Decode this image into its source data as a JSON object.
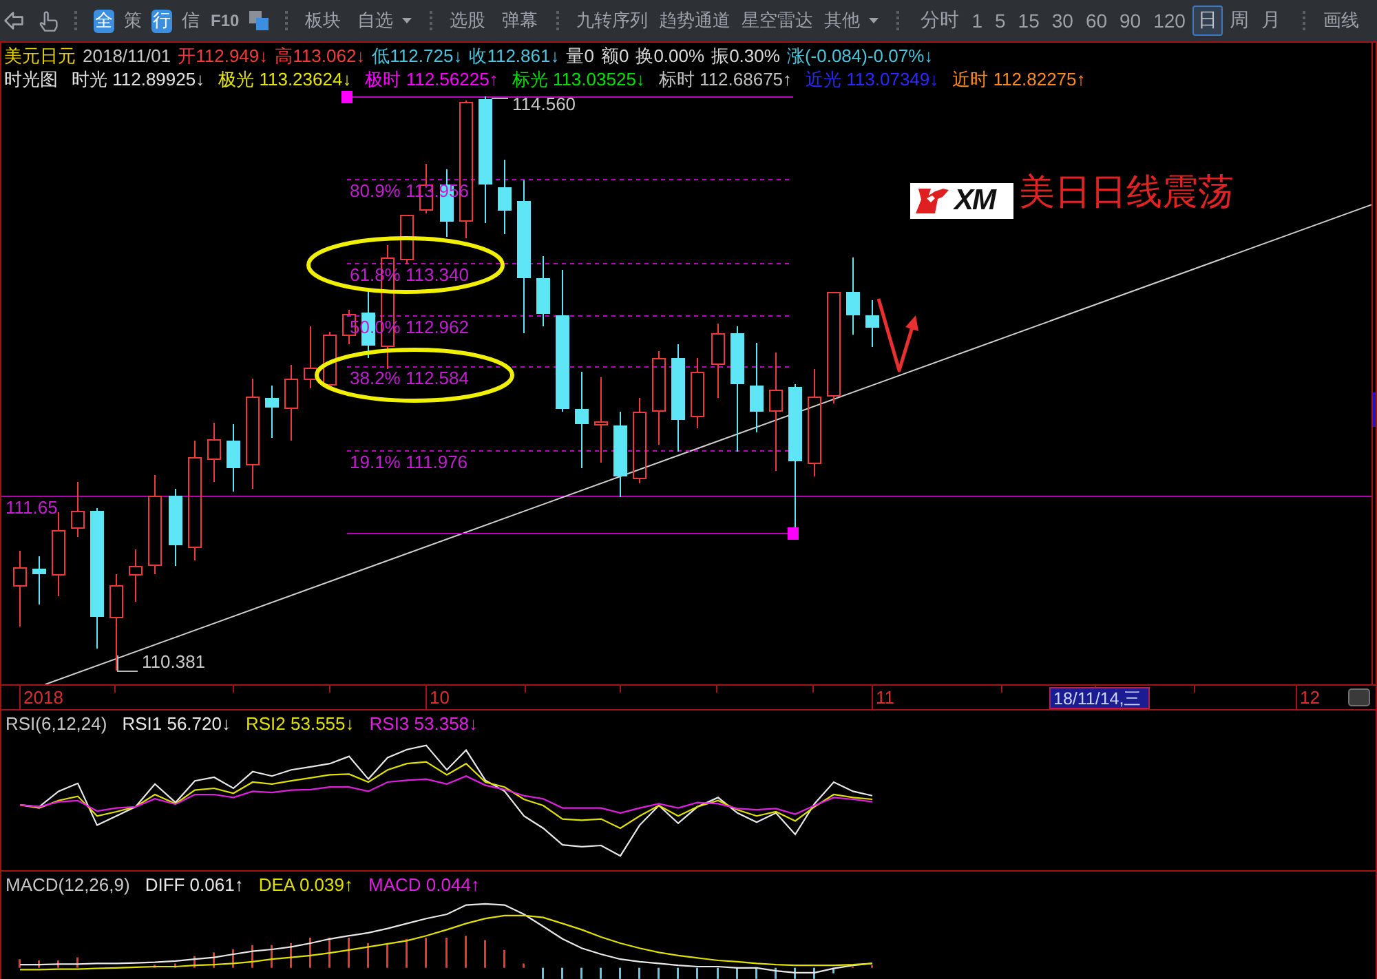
{
  "toolbar": {
    "groups": [
      {
        "items": [
          {
            "kind": "badge",
            "label": "全"
          },
          {
            "kind": "text",
            "label": "策"
          },
          {
            "kind": "badge",
            "label": "行"
          },
          {
            "kind": "text",
            "label": "信"
          },
          {
            "kind": "text",
            "label": "F10"
          }
        ]
      },
      {
        "items": [
          {
            "kind": "text",
            "label": "板块"
          },
          {
            "kind": "dropdown",
            "label": "自选"
          }
        ]
      },
      {
        "items": [
          {
            "kind": "text",
            "label": "选股"
          },
          {
            "kind": "text",
            "label": "弹幕"
          }
        ]
      },
      {
        "items": [
          {
            "kind": "text",
            "label": "九转序列"
          },
          {
            "kind": "text",
            "label": "趋势通道"
          },
          {
            "kind": "text",
            "label": "星空雷达"
          },
          {
            "kind": "dropdown",
            "label": "其他"
          }
        ]
      },
      {
        "items": [
          {
            "kind": "tab",
            "label": "分时",
            "selected": false
          },
          {
            "kind": "tab",
            "label": "1",
            "selected": false
          },
          {
            "kind": "tab",
            "label": "5",
            "selected": false
          },
          {
            "kind": "tab",
            "label": "15",
            "selected": false
          },
          {
            "kind": "tab",
            "label": "30",
            "selected": false
          },
          {
            "kind": "tab",
            "label": "60",
            "selected": false
          },
          {
            "kind": "tab",
            "label": "90",
            "selected": false
          },
          {
            "kind": "tab",
            "label": "120",
            "selected": false
          },
          {
            "kind": "tab",
            "label": "日",
            "selected": true
          },
          {
            "kind": "tab",
            "label": "周",
            "selected": false
          },
          {
            "kind": "tab",
            "label": "月",
            "selected": false
          }
        ]
      },
      {
        "items": [
          {
            "kind": "text",
            "label": "画线"
          }
        ]
      }
    ]
  },
  "chart": {
    "quote": [
      {
        "text": "美元日元",
        "color": "#e6d000"
      },
      {
        "text": "2018/11/01",
        "color": "#c8c8c8"
      },
      {
        "text": "开112.949↓",
        "color": "#f23b3b"
      },
      {
        "text": "高113.062↓",
        "color": "#f23b3b"
      },
      {
        "text": "低112.725↓",
        "color": "#4cc4dc"
      },
      {
        "text": "收112.861↓",
        "color": "#4cc4dc"
      },
      {
        "text": "量0",
        "color": "#d8d8d8"
      },
      {
        "text": "额0",
        "color": "#d8d8d8"
      },
      {
        "text": "换0.00%",
        "color": "#d8d8d8"
      },
      {
        "text": "振0.30%",
        "color": "#d8d8d8"
      },
      {
        "text": "涨(-0.084)-0.07%↓",
        "color": "#4cc4dc"
      }
    ],
    "indicators": [
      {
        "text": "时光图",
        "color": "#e0e0e0"
      },
      {
        "text": "时光 112.89925↓",
        "color": "#e0e0e0"
      },
      {
        "text": "极光 113.23624↓",
        "color": "#e6e600"
      },
      {
        "text": "极时 112.56225↑",
        "color": "#ff00ff"
      },
      {
        "text": "标光 113.03525↓",
        "color": "#00e000"
      },
      {
        "text": "标时 112.68675↑",
        "color": "#c0c0c0"
      },
      {
        "text": "近光 113.07349↓",
        "color": "#2a2aff"
      },
      {
        "text": "近时 112.82275↑",
        "color": "#ff8a1e"
      }
    ],
    "fibonacci": {
      "high_label": "114.560",
      "levels": [
        {
          "label": "80.9% 113.956"
        },
        {
          "label": "61.8% 113.340"
        },
        {
          "label": "50.0% 112.962"
        },
        {
          "label": "38.2% 112.584"
        },
        {
          "label": "19.1% 111.976"
        }
      ]
    },
    "support_label": "111.65",
    "low_label": "110.381",
    "caption": "美日日线震荡",
    "logo_text": "XM"
  },
  "time_axis": {
    "labels": [
      {
        "kind": "tick",
        "text": "2018"
      },
      {
        "kind": "tick",
        "text": "10"
      },
      {
        "kind": "tick",
        "text": "11"
      },
      {
        "kind": "cursor",
        "text": "18/11/14,三"
      },
      {
        "kind": "tick",
        "text": "12"
      }
    ]
  },
  "rsi": {
    "title": "RSI(6,12,24)",
    "series": [
      {
        "label": "RSI1 56.720↓",
        "color": "#e8e8e8"
      },
      {
        "label": "RSI2 53.555↓",
        "color": "#e0e000"
      },
      {
        "label": "RSI3 53.358↓",
        "color": "#e020e0"
      }
    ]
  },
  "macd": {
    "title": "MACD(12,26,9)",
    "series": [
      {
        "label": "DIFF 0.061↑",
        "color": "#e8e8e8"
      },
      {
        "label": "DEA 0.039↑",
        "color": "#e0e000"
      },
      {
        "label": "MACD 0.044↑",
        "color": "#e020e0"
      }
    ]
  }
}
